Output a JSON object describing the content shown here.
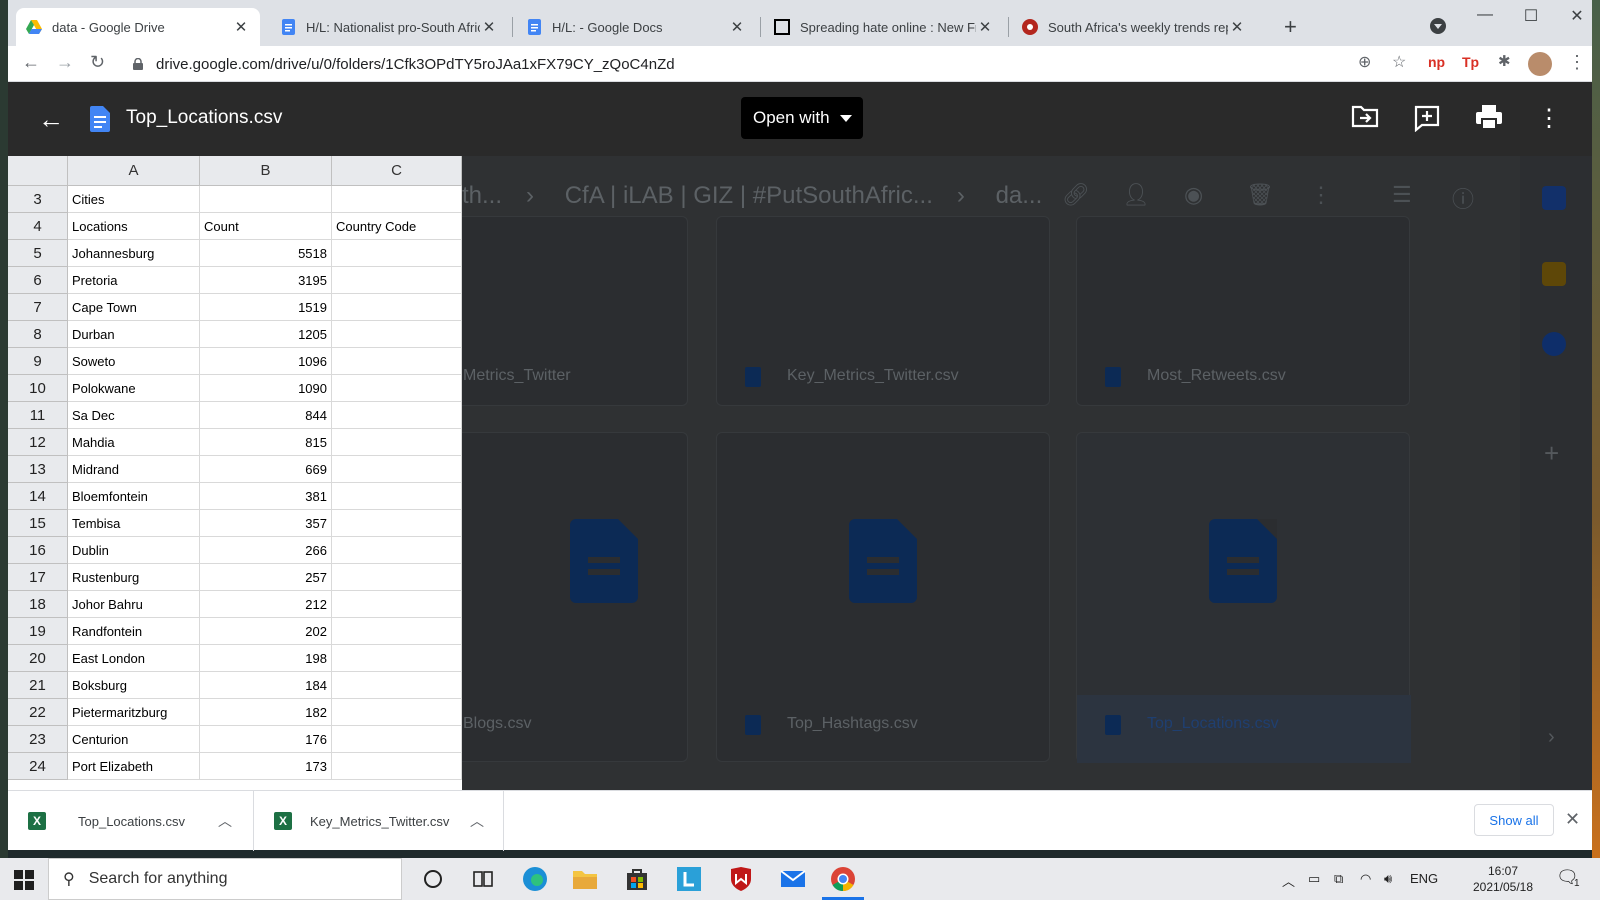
{
  "browser": {
    "tabs": [
      {
        "title": "data - Google Drive",
        "favicon": "google-drive-icon",
        "active": true
      },
      {
        "title": "H/L: Nationalist pro-South Africa",
        "favicon": "google-docs-icon",
        "active": false
      },
      {
        "title": "H/L: - Google Docs",
        "favicon": "google-docs-icon",
        "active": false
      },
      {
        "title": "Spreading hate online : New Fran",
        "favicon": "black-square-icon",
        "active": false
      },
      {
        "title": "South Africa's weekly trends repo",
        "favicon": "red-circle-icon",
        "active": false
      }
    ],
    "url": "drive.google.com/drive/u/0/folders/1Cfk3OPdTY5roJAa1xFX79CY_zQoC4nZd",
    "extensions": [
      "np",
      "Tp"
    ]
  },
  "viewer": {
    "file_name": "Top_Locations.csv",
    "open_with_label": "Open with",
    "actions": [
      "add-to-folder-icon",
      "add-comment-icon",
      "print-icon",
      "more-vert-icon"
    ]
  },
  "drive_background": {
    "breadcrumb": [
      "th...",
      "CfA | iLAB | GIZ | #PutSouthAfric...",
      "da..."
    ],
    "files": [
      "Metrics_Twitter",
      "Key_Metrics_Twitter.csv",
      "Most_Retweets.csv",
      "Blogs.csv",
      "Top_Hashtags.csv",
      "Top_Locations.csv"
    ]
  },
  "sheet": {
    "columns": [
      "A",
      "B",
      "C"
    ],
    "rows": [
      {
        "n": "3",
        "a": "Cities",
        "b": "",
        "c": ""
      },
      {
        "n": "4",
        "a": "Locations",
        "b": "Count",
        "c": "Country Code"
      },
      {
        "n": "5",
        "a": "Johannesburg",
        "b": "5518",
        "c": ""
      },
      {
        "n": "6",
        "a": "Pretoria",
        "b": "3195",
        "c": ""
      },
      {
        "n": "7",
        "a": "Cape Town",
        "b": "1519",
        "c": ""
      },
      {
        "n": "8",
        "a": "Durban",
        "b": "1205",
        "c": ""
      },
      {
        "n": "9",
        "a": "Soweto",
        "b": "1096",
        "c": ""
      },
      {
        "n": "10",
        "a": "Polokwane",
        "b": "1090",
        "c": ""
      },
      {
        "n": "11",
        "a": "Sa Dec",
        "b": "844",
        "c": ""
      },
      {
        "n": "12",
        "a": "Mahdia",
        "b": "815",
        "c": ""
      },
      {
        "n": "13",
        "a": "Midrand",
        "b": "669",
        "c": ""
      },
      {
        "n": "14",
        "a": "Bloemfontein",
        "b": "381",
        "c": ""
      },
      {
        "n": "15",
        "a": "Tembisa",
        "b": "357",
        "c": ""
      },
      {
        "n": "16",
        "a": "Dublin",
        "b": "266",
        "c": ""
      },
      {
        "n": "17",
        "a": "Rustenburg",
        "b": "257",
        "c": ""
      },
      {
        "n": "18",
        "a": "Johor Bahru",
        "b": "212",
        "c": ""
      },
      {
        "n": "19",
        "a": "Randfontein",
        "b": "202",
        "c": ""
      },
      {
        "n": "20",
        "a": "East London",
        "b": "198",
        "c": ""
      },
      {
        "n": "21",
        "a": "Boksburg",
        "b": "184",
        "c": ""
      },
      {
        "n": "22",
        "a": "Pietermaritzburg",
        "b": "182",
        "c": ""
      },
      {
        "n": "23",
        "a": "Centurion",
        "b": "176",
        "c": ""
      },
      {
        "n": "24",
        "a": "Port Elizabeth",
        "b": "173",
        "c": ""
      }
    ]
  },
  "downloads": {
    "items": [
      "Top_Locations.csv",
      "Key_Metrics_Twitter.csv"
    ],
    "show_all_label": "Show all"
  },
  "taskbar": {
    "search_placeholder": "Search for anything",
    "language": "ENG",
    "time": "16:07",
    "date": "2021/05/18",
    "notification_count": "1"
  }
}
